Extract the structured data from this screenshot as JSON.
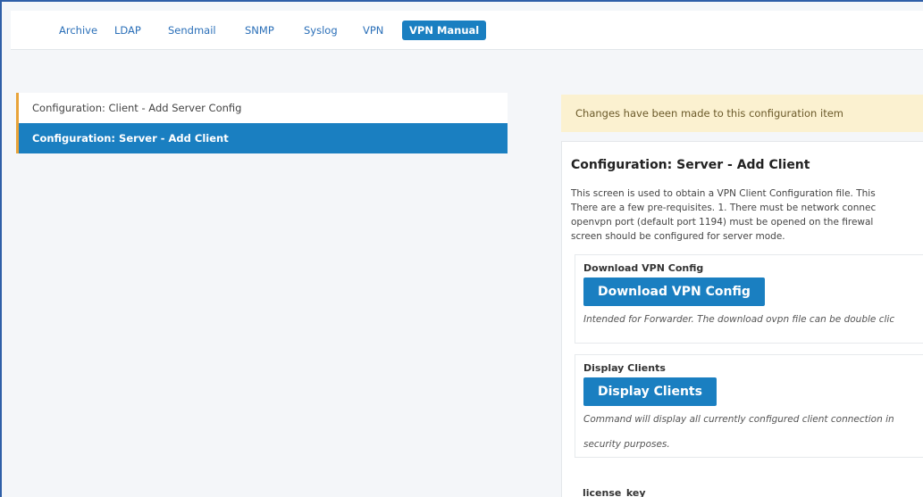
{
  "tabs": [
    {
      "label": "Archive",
      "active": false
    },
    {
      "label": "LDAP",
      "active": false
    },
    {
      "label": "Sendmail",
      "active": false
    },
    {
      "label": "SNMP",
      "active": false
    },
    {
      "label": "Syslog",
      "active": false
    },
    {
      "label": "VPN",
      "active": false
    },
    {
      "label": "VPN Manual",
      "active": true
    }
  ],
  "config_list": [
    {
      "label": "Configuration: Client - Add Server Config",
      "selected": false
    },
    {
      "label": "Configuration: Server - Add Client",
      "selected": true
    }
  ],
  "notice": "Changes have been made to this configuration item",
  "panel": {
    "title": "Configuration: Server - Add Client",
    "description_lines": [
      "This screen is used to obtain a VPN Client Configuration file. This",
      "There are a few pre-requisites. 1. There must be network connec",
      "openvpn port (default port 1194) must be opened on the firewal",
      "screen should be configured for server mode."
    ],
    "sections": [
      {
        "label": "Download VPN Config",
        "button": "Download VPN Config",
        "notes": [
          "Intended for Forwarder. The download ovpn file can be double clic"
        ]
      },
      {
        "label": "Display Clients",
        "button": "Display Clients",
        "notes": [
          "Command will display all currently configured client connection in",
          "security purposes."
        ]
      }
    ],
    "next_label": "license_key"
  },
  "colors": {
    "accent": "#1a7fc1",
    "tab_text": "#2a6fb8",
    "notice_bg": "#fbf1d0",
    "left_marker": "#e8a33a"
  }
}
